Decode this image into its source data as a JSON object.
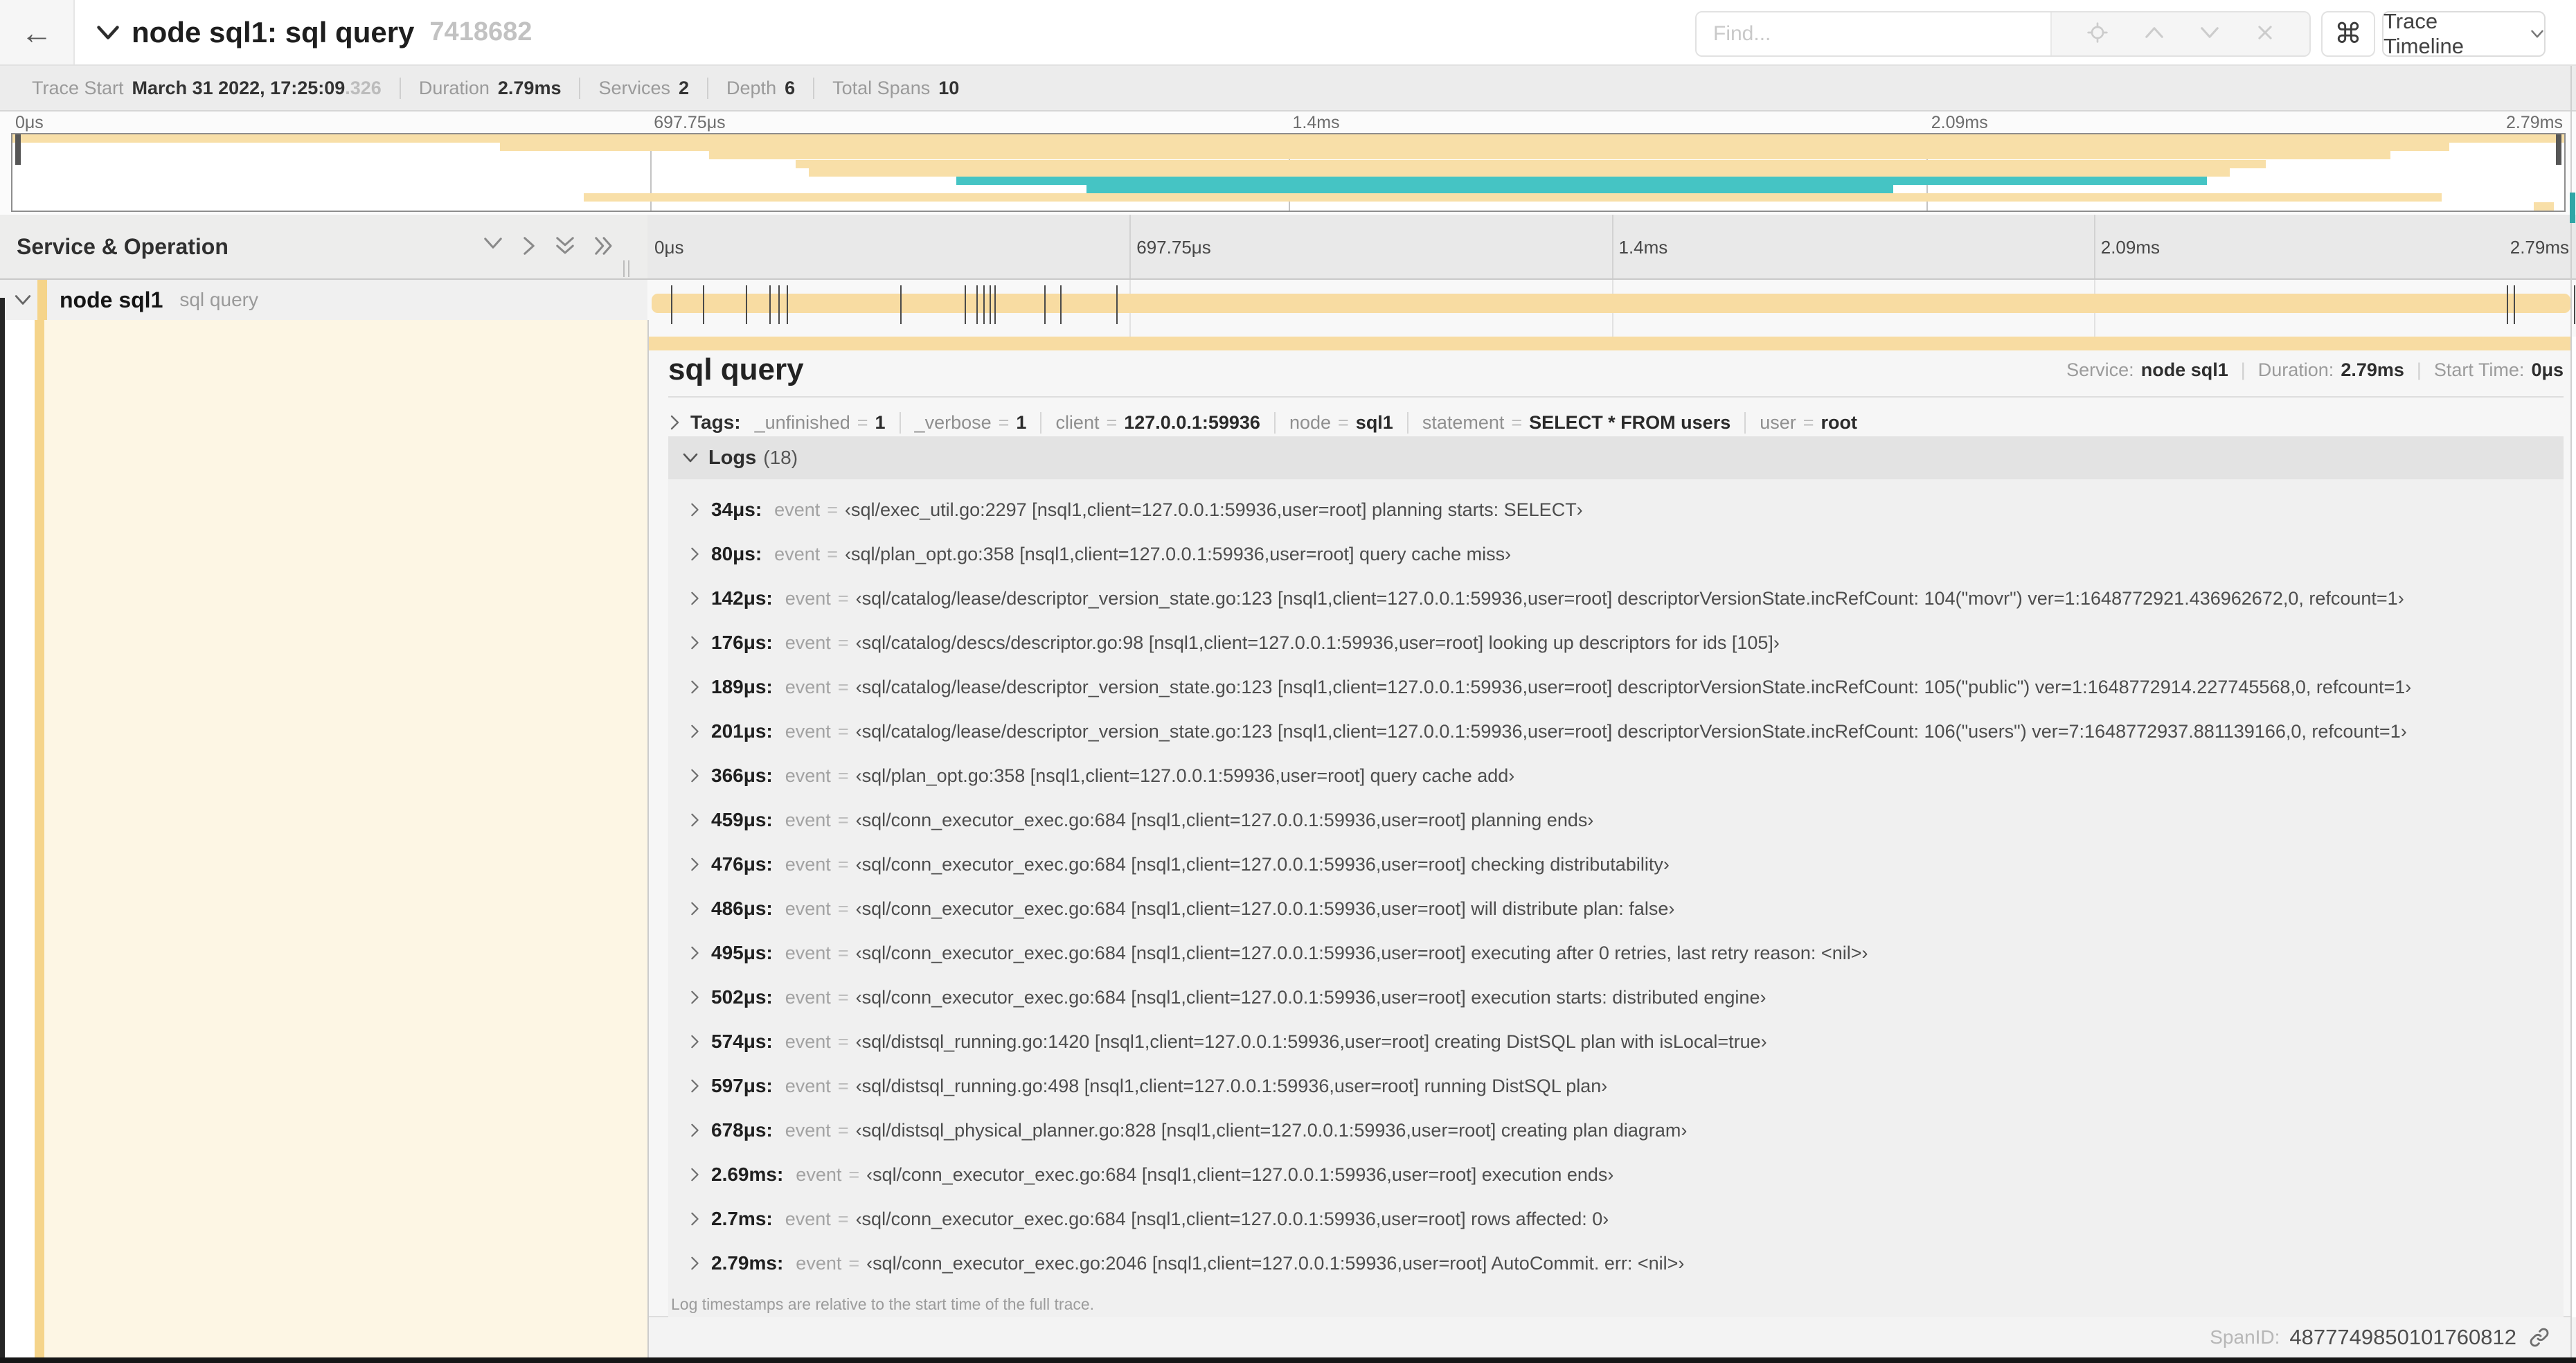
{
  "header": {
    "back_arrow": "←",
    "title": "node sql1: sql query",
    "trace_id": "7418682",
    "find_placeholder": "Find...",
    "shortcut_icon": "⌘",
    "view_selector": "Trace Timeline"
  },
  "summary": {
    "items": [
      {
        "label": "Trace Start",
        "value": "March 31 2022, 17:25:09",
        "suffix": ".326"
      },
      {
        "label": "Duration",
        "value": "2.79ms"
      },
      {
        "label": "Services",
        "value": "2"
      },
      {
        "label": "Depth",
        "value": "6"
      },
      {
        "label": "Total Spans",
        "value": "10"
      }
    ]
  },
  "minimap": {
    "ticks": [
      {
        "label": "0μs",
        "pct": 0
      },
      {
        "label": "697.75μs",
        "pct": 25
      },
      {
        "label": "1.4ms",
        "pct": 50
      },
      {
        "label": "2.09ms",
        "pct": 75
      },
      {
        "label": "2.79ms",
        "pct": 100
      }
    ],
    "colors": {
      "tan": "#f8dfa8",
      "teal": "#45c4c4"
    },
    "bars": [
      {
        "row": 0,
        "start": 0,
        "end": 100,
        "color": "tan"
      },
      {
        "row": 1,
        "start": 19.1,
        "end": 95.5,
        "color": "tan"
      },
      {
        "row": 2,
        "start": 27.3,
        "end": 93.2,
        "color": "tan"
      },
      {
        "row": 3,
        "start": 30.7,
        "end": 88.3,
        "color": "tan"
      },
      {
        "row": 4,
        "start": 31.2,
        "end": 86.9,
        "color": "tan"
      },
      {
        "row": 5,
        "start": 37.0,
        "end": 86.0,
        "color": "teal"
      },
      {
        "row": 6,
        "start": 42.1,
        "end": 73.7,
        "color": "teal"
      },
      {
        "row": 7,
        "start": 22.4,
        "end": 95.2,
        "color": "tan"
      },
      {
        "row": 8,
        "start": 98.8,
        "end": 99.6,
        "color": "tan"
      }
    ]
  },
  "timeline": {
    "left_header": "Service & Operation",
    "ticks": [
      {
        "label": "0μs",
        "pct": 0
      },
      {
        "label": "697.75μs",
        "pct": 25
      },
      {
        "label": "1.4ms",
        "pct": 50
      },
      {
        "label": "2.09ms",
        "pct": 75
      },
      {
        "label": "2.79ms",
        "pct": 100
      }
    ],
    "row": {
      "service": "node sql1",
      "operation": "sql query",
      "bar_start_pct": 0.2,
      "bar_end_pct": 99.7,
      "log_marks_pct": [
        1.22,
        2.87,
        5.09,
        6.31,
        6.77,
        7.2,
        13.12,
        16.45,
        17.06,
        17.42,
        17.74,
        17.99,
        20.57,
        21.4,
        24.3,
        96.42,
        96.77,
        99.9
      ]
    }
  },
  "detail": {
    "title": "sql query",
    "meta": {
      "service_label": "Service:",
      "service": "node sql1",
      "duration_label": "Duration:",
      "duration": "2.79ms",
      "start_label": "Start Time:",
      "start": "0μs"
    },
    "tags_label": "Tags:",
    "eq": "=",
    "field_label": "event",
    "tags": [
      {
        "key": "_unfinished",
        "value": "1"
      },
      {
        "key": "_verbose",
        "value": "1"
      },
      {
        "key": "client",
        "value": "127.0.0.1:59936"
      },
      {
        "key": "node",
        "value": "sql1"
      },
      {
        "key": "statement",
        "value": "SELECT * FROM users"
      },
      {
        "key": "user",
        "value": "root"
      }
    ],
    "logs_label": "Logs",
    "logs_count": "(18)",
    "logs": [
      {
        "time": "34μs:",
        "value": "‹sql/exec_util.go:2297 [nsql1,client=127.0.0.1:59936,user=root] planning starts: SELECT›"
      },
      {
        "time": "80μs:",
        "value": "‹sql/plan_opt.go:358 [nsql1,client=127.0.0.1:59936,user=root] query cache miss›"
      },
      {
        "time": "142μs:",
        "value": "‹sql/catalog/lease/descriptor_version_state.go:123 [nsql1,client=127.0.0.1:59936,user=root] descriptorVersionState.incRefCount: 104(\"movr\") ver=1:1648772921.436962672,0, refcount=1›"
      },
      {
        "time": "176μs:",
        "value": "‹sql/catalog/descs/descriptor.go:98 [nsql1,client=127.0.0.1:59936,user=root] looking up descriptors for ids [105]›"
      },
      {
        "time": "189μs:",
        "value": "‹sql/catalog/lease/descriptor_version_state.go:123 [nsql1,client=127.0.0.1:59936,user=root] descriptorVersionState.incRefCount: 105(\"public\") ver=1:1648772914.227745568,0, refcount=1›"
      },
      {
        "time": "201μs:",
        "value": "‹sql/catalog/lease/descriptor_version_state.go:123 [nsql1,client=127.0.0.1:59936,user=root] descriptorVersionState.incRefCount: 106(\"users\") ver=7:1648772937.881139166,0, refcount=1›"
      },
      {
        "time": "366μs:",
        "value": "‹sql/plan_opt.go:358 [nsql1,client=127.0.0.1:59936,user=root] query cache add›"
      },
      {
        "time": "459μs:",
        "value": "‹sql/conn_executor_exec.go:684 [nsql1,client=127.0.0.1:59936,user=root] planning ends›"
      },
      {
        "time": "476μs:",
        "value": "‹sql/conn_executor_exec.go:684 [nsql1,client=127.0.0.1:59936,user=root] checking distributability›"
      },
      {
        "time": "486μs:",
        "value": "‹sql/conn_executor_exec.go:684 [nsql1,client=127.0.0.1:59936,user=root] will distribute plan: false›"
      },
      {
        "time": "495μs:",
        "value": "‹sql/conn_executor_exec.go:684 [nsql1,client=127.0.0.1:59936,user=root] executing after 0 retries, last retry reason: <nil>›"
      },
      {
        "time": "502μs:",
        "value": "‹sql/conn_executor_exec.go:684 [nsql1,client=127.0.0.1:59936,user=root] execution starts: distributed engine›"
      },
      {
        "time": "574μs:",
        "value": "‹sql/distsql_running.go:1420 [nsql1,client=127.0.0.1:59936,user=root] creating DistSQL plan with isLocal=true›"
      },
      {
        "time": "597μs:",
        "value": "‹sql/distsql_running.go:498 [nsql1,client=127.0.0.1:59936,user=root] running DistSQL plan›"
      },
      {
        "time": "678μs:",
        "value": "‹sql/distsql_physical_planner.go:828 [nsql1,client=127.0.0.1:59936,user=root] creating plan diagram›"
      },
      {
        "time": "2.69ms:",
        "value": "‹sql/conn_executor_exec.go:684 [nsql1,client=127.0.0.1:59936,user=root] execution ends›"
      },
      {
        "time": "2.7ms:",
        "value": "‹sql/conn_executor_exec.go:684 [nsql1,client=127.0.0.1:59936,user=root] rows affected: 0›"
      },
      {
        "time": "2.79ms:",
        "value": "‹sql/conn_executor_exec.go:2046 [nsql1,client=127.0.0.1:59936,user=root] AutoCommit. err: <nil>›"
      }
    ],
    "note": "Log timestamps are relative to the start time of the full trace.",
    "footer": {
      "label": "SpanID:",
      "value": "4877749850101760812"
    }
  }
}
